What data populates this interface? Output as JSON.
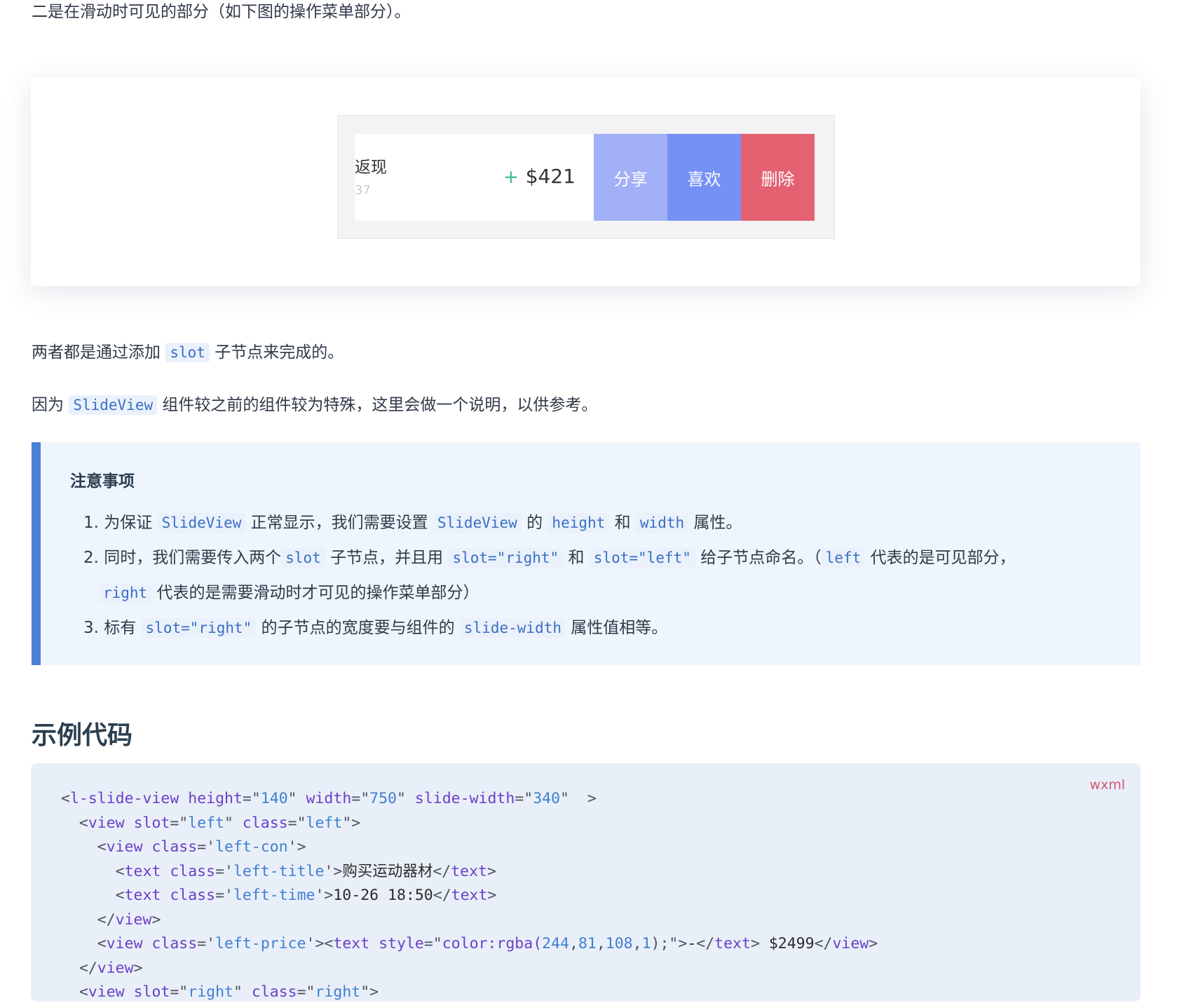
{
  "intro_text": "二是在滑动时可见的部分（如下图的操作菜单部分）。",
  "demo": {
    "row_title": "返现",
    "row_sub": "37",
    "plus": "+",
    "price": "$421",
    "buttons": [
      {
        "label": "分享",
        "color": "#9eadf9"
      },
      {
        "label": "喜欢",
        "color": "#6f8cf6"
      },
      {
        "label": "删除",
        "color": "#e35a6a"
      }
    ]
  },
  "paragraphs": [
    [
      {
        "t": "两者都是通过添加 "
      },
      {
        "c": "slot"
      },
      {
        "t": " 子节点来完成的。"
      }
    ],
    [
      {
        "t": "因为 "
      },
      {
        "c": "SlideView"
      },
      {
        "t": " 组件较之前的组件较为特殊，这里会做一个说明，以供参考。"
      }
    ]
  ],
  "note": {
    "title": "注意事项",
    "items": [
      [
        {
          "t": "1. 为保证 "
        },
        {
          "c": "SlideView"
        },
        {
          "t": " 正常显示，我们需要设置 "
        },
        {
          "c": "SlideView"
        },
        {
          "t": " 的 "
        },
        {
          "c": "height"
        },
        {
          "t": " 和 "
        },
        {
          "c": "width"
        },
        {
          "t": " 属性。"
        }
      ],
      [
        {
          "t": "2. 同时，我们需要传入两个"
        },
        {
          "c": "slot"
        },
        {
          "t": " 子节点，并且用 "
        },
        {
          "c": "slot=\"right\""
        },
        {
          "t": " 和 "
        },
        {
          "c": "slot=\"left\""
        },
        {
          "t": " 给子节点命名。（"
        },
        {
          "c": "left"
        },
        {
          "t": " 代表的是可见部分，"
        }
      ],
      [
        {
          "t": "   "
        },
        {
          "c": "right"
        },
        {
          "t": " 代表的是需要滑动时才可见的操作菜单部分）"
        }
      ],
      [
        {
          "t": "3. 标有 "
        },
        {
          "c": "slot=\"right\""
        },
        {
          "t": " 的子节点的宽度要与组件的 "
        },
        {
          "c": "slide-width"
        },
        {
          "t": " 属性值相等。"
        }
      ]
    ]
  },
  "section_heading": "示例代码",
  "code": {
    "language": "wxml",
    "lines": [
      [
        [
          "p",
          "<"
        ],
        [
          "t",
          "l-slide-view"
        ],
        [
          "p",
          " "
        ],
        [
          "a",
          "height"
        ],
        [
          "p",
          "=\""
        ],
        [
          "s",
          "140"
        ],
        [
          "p",
          "\" "
        ],
        [
          "a",
          "width"
        ],
        [
          "p",
          "=\""
        ],
        [
          "s",
          "750"
        ],
        [
          "p",
          "\" "
        ],
        [
          "a",
          "slide-width"
        ],
        [
          "p",
          "=\""
        ],
        [
          "s",
          "340"
        ],
        [
          "p",
          "\"  >"
        ]
      ],
      [
        [
          "p",
          "  <"
        ],
        [
          "t",
          "view"
        ],
        [
          "p",
          " "
        ],
        [
          "a",
          "slot"
        ],
        [
          "p",
          "=\""
        ],
        [
          "s",
          "left"
        ],
        [
          "p",
          "\" "
        ],
        [
          "a",
          "class"
        ],
        [
          "p",
          "=\""
        ],
        [
          "s",
          "left"
        ],
        [
          "p",
          "\">"
        ]
      ],
      [
        [
          "p",
          "    <"
        ],
        [
          "t",
          "view"
        ],
        [
          "p",
          " "
        ],
        [
          "a",
          "class"
        ],
        [
          "p",
          "='"
        ],
        [
          "s",
          "left-con"
        ],
        [
          "p",
          "'>"
        ]
      ],
      [
        [
          "p",
          "      <"
        ],
        [
          "t",
          "text"
        ],
        [
          "p",
          " "
        ],
        [
          "a",
          "class"
        ],
        [
          "p",
          "='"
        ],
        [
          "s",
          "left-title"
        ],
        [
          "p",
          "'>"
        ],
        [
          "x",
          "购买运动器材"
        ],
        [
          "p",
          "</"
        ],
        [
          "t",
          "text"
        ],
        [
          "p",
          ">"
        ]
      ],
      [
        [
          "p",
          "      <"
        ],
        [
          "t",
          "text"
        ],
        [
          "p",
          " "
        ],
        [
          "a",
          "class"
        ],
        [
          "p",
          "='"
        ],
        [
          "s",
          "left-time"
        ],
        [
          "p",
          "'>"
        ],
        [
          "x",
          "10-26 18:50"
        ],
        [
          "p",
          "</"
        ],
        [
          "t",
          "text"
        ],
        [
          "p",
          ">"
        ]
      ],
      [
        [
          "p",
          "    </"
        ],
        [
          "t",
          "view"
        ],
        [
          "p",
          ">"
        ]
      ],
      [
        [
          "p",
          "    <"
        ],
        [
          "t",
          "view"
        ],
        [
          "p",
          " "
        ],
        [
          "a",
          "class"
        ],
        [
          "p",
          "='"
        ],
        [
          "s",
          "left-price"
        ],
        [
          "p",
          "'><"
        ],
        [
          "t",
          "text"
        ],
        [
          "p",
          " "
        ],
        [
          "a",
          "style"
        ],
        [
          "p",
          "=\""
        ],
        [
          "a",
          "color:rgba("
        ],
        [
          "s",
          "244"
        ],
        [
          "p",
          ","
        ],
        [
          "s",
          "81"
        ],
        [
          "p",
          ","
        ],
        [
          "s",
          "108"
        ],
        [
          "p",
          ","
        ],
        [
          "s",
          "1"
        ],
        [
          "p",
          ");\">"
        ],
        [
          "x",
          "-"
        ],
        [
          "p",
          "</"
        ],
        [
          "t",
          "text"
        ],
        [
          "p",
          "> "
        ],
        [
          "x",
          "$2499"
        ],
        [
          "p",
          "</"
        ],
        [
          "t",
          "view"
        ],
        [
          "p",
          ">"
        ]
      ],
      [
        [
          "p",
          "  </"
        ],
        [
          "t",
          "view"
        ],
        [
          "p",
          ">"
        ]
      ],
      [
        [
          "p",
          "  <"
        ],
        [
          "t",
          "view"
        ],
        [
          "p",
          " "
        ],
        [
          "a",
          "slot"
        ],
        [
          "p",
          "=\""
        ],
        [
          "s",
          "right"
        ],
        [
          "p",
          "\" "
        ],
        [
          "a",
          "class"
        ],
        [
          "p",
          "=\""
        ],
        [
          "s",
          "right"
        ],
        [
          "p",
          "\">"
        ]
      ]
    ]
  }
}
